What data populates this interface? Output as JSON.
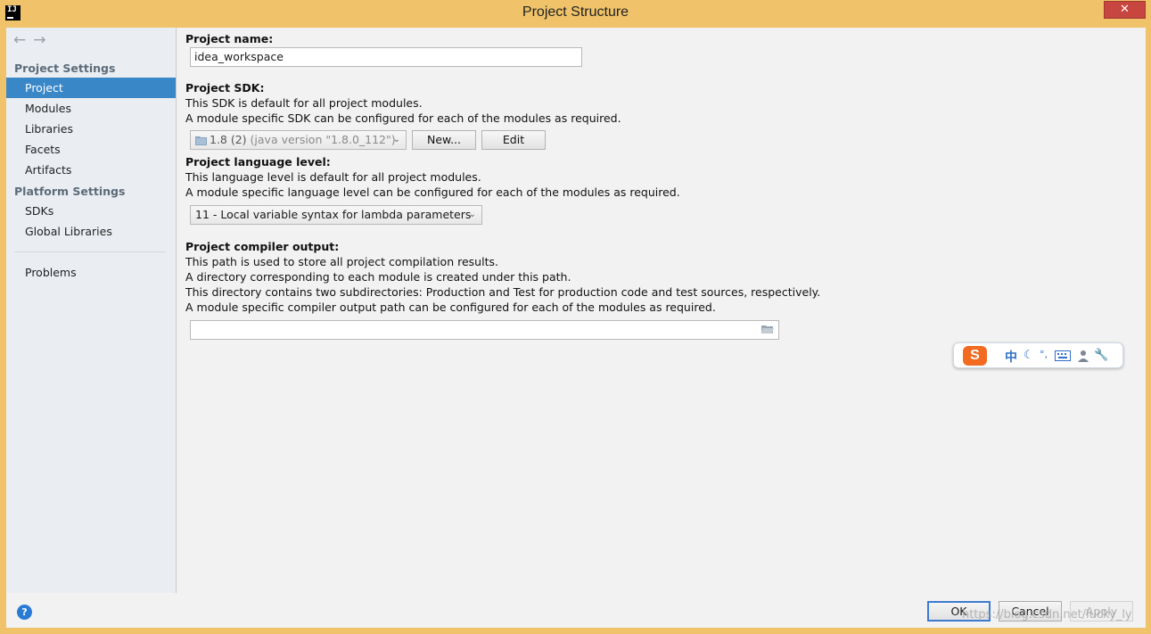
{
  "window": {
    "title": "Project Structure",
    "app_icon_text": "IJ",
    "close_symbol": "✕"
  },
  "sidebar": {
    "back_arrow": "←",
    "forward_arrow": "→",
    "project_settings_header": "Project Settings",
    "project_settings_items": [
      "Project",
      "Modules",
      "Libraries",
      "Facets",
      "Artifacts"
    ],
    "platform_settings_header": "Platform Settings",
    "platform_settings_items": [
      "SDKs",
      "Global Libraries"
    ],
    "problems_label": "Problems",
    "selected_item": "Project"
  },
  "main": {
    "project_name_label": "Project name:",
    "project_name_value": "idea_workspace",
    "sdk_label": "Project SDK:",
    "sdk_desc_1": "This SDK is default for all project modules.",
    "sdk_desc_2": "A module specific SDK can be configured for each of the modules as required.",
    "sdk_selected": "1.8 (2)",
    "sdk_selected_detail": "(java version \"1.8.0_112\")",
    "sdk_new_button": "New...",
    "sdk_edit_button": "Edit",
    "language_level_label": "Project language level:",
    "language_level_desc_1": "This language level is default for all project modules.",
    "language_level_desc_2": "A module specific language level can be configured for each of the modules as required.",
    "language_level_selected": "11 - Local variable syntax for lambda parameters",
    "compiler_output_label": "Project compiler output:",
    "compiler_output_desc_1": "This path is used to store all project compilation results.",
    "compiler_output_desc_2": "A directory corresponding to each module is created under this path.",
    "compiler_output_desc_3": "This directory contains two subdirectories: Production and Test for production code and test sources, respectively.",
    "compiler_output_desc_4": "A module specific compiler output path can be configured for each of the modules as required.",
    "compiler_output_value": ""
  },
  "ime_toolbar": {
    "logo": "S",
    "mode": "中",
    "icons": [
      "moon-icon",
      "punctuation-icon",
      "keyboard-icon",
      "user-icon",
      "wrench-icon"
    ]
  },
  "footer": {
    "help_symbol": "?",
    "ok_button": "OK",
    "cancel_button": "Cancel",
    "apply_button": "Apply",
    "watermark": "https://blog.csdn.net/lucky_ly"
  },
  "colors": {
    "title_bar": "#f0c36a",
    "selection": "#3a87c8",
    "close_button": "#c7463f",
    "ime_logo": "#f26b21"
  }
}
